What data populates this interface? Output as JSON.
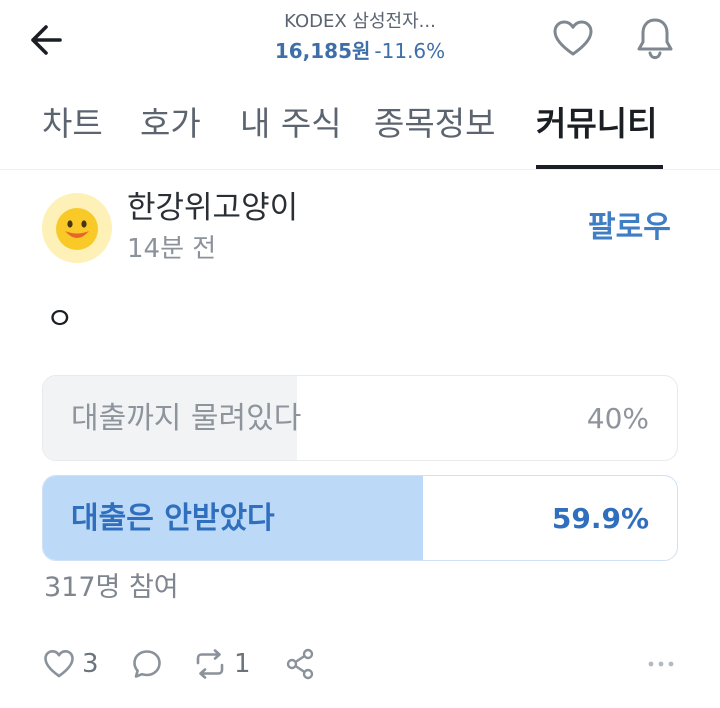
{
  "header": {
    "stock_name": "KODEX 삼성전자...",
    "price": "16,185원",
    "change": "-11.6%",
    "icons": {
      "back": "back-arrow-icon",
      "favorite": "heart-icon",
      "notification": "bell-icon"
    }
  },
  "tabs": [
    {
      "label": "차트",
      "active": false
    },
    {
      "label": "호가",
      "active": false
    },
    {
      "label": "내 주식",
      "active": false
    },
    {
      "label": "종목정보",
      "active": false
    },
    {
      "label": "커뮤니티",
      "active": true
    }
  ],
  "post": {
    "author": "한강위고양이",
    "time": "14분 전",
    "follow_label": "팔로우",
    "body": "ㅇ",
    "poll": {
      "options": [
        {
          "label": "대출까지 물려있다",
          "percent_text": "40%",
          "percent": 40,
          "selected": false
        },
        {
          "label": "대출은 안받았다",
          "percent_text": "59.9%",
          "percent": 59.9,
          "selected": true
        }
      ],
      "participants": "317명 참여"
    },
    "actions": {
      "likes": "3",
      "reposts": "1",
      "icons": [
        "heart-icon",
        "comment-icon",
        "repost-icon",
        "share-icon",
        "more-icon"
      ]
    }
  },
  "colors": {
    "accent": "#3f7dc4",
    "price": "#3f6fa8",
    "poll_selected_fill": "#bcd9f7",
    "poll_default_fill": "#f2f3f5"
  }
}
